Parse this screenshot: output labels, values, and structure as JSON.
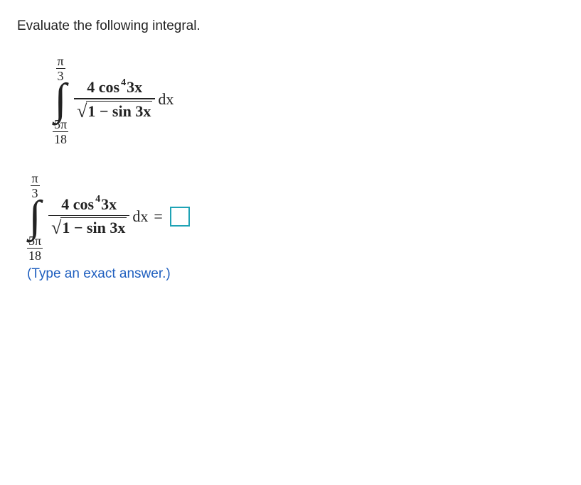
{
  "prompt": "Evaluate the following integral.",
  "integral": {
    "upper_num": "π",
    "upper_den": "3",
    "lower_num": "5π",
    "lower_den": "18",
    "numerator_coef": "4 cos",
    "numerator_exp": "4",
    "numerator_arg": "3x",
    "denom_radicand": "1 − sin 3x",
    "dx": "dx"
  },
  "equals": "=",
  "hint": "(Type an exact answer.)"
}
